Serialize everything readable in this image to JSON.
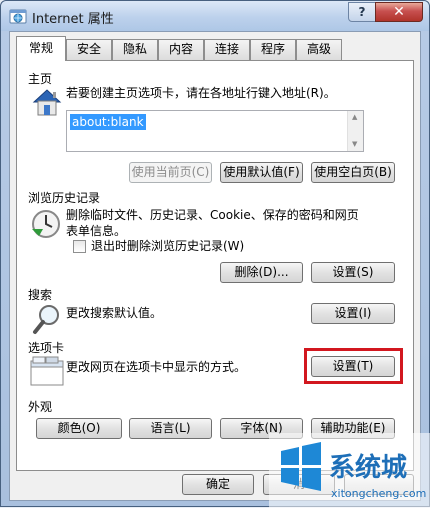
{
  "window": {
    "title": "Internet 属性",
    "help_glyph": "?",
    "close_glyph": "✕"
  },
  "tabs": [
    {
      "label": "常规"
    },
    {
      "label": "安全"
    },
    {
      "label": "隐私"
    },
    {
      "label": "内容"
    },
    {
      "label": "连接"
    },
    {
      "label": "程序"
    },
    {
      "label": "高级"
    }
  ],
  "home": {
    "title": "主页",
    "desc": "若要创建主页选项卡，请在各地址行键入地址(R)。",
    "url": "about:blank",
    "buttons": {
      "use_current": "使用当前页(C)",
      "use_default": "使用默认值(F)",
      "use_blank": "使用空白页(B)"
    }
  },
  "history": {
    "title": "浏览历史记录",
    "desc_line1": "删除临时文件、历史记录、Cookie、保存的密码和网页",
    "desc_line2": "表单信息。",
    "checkbox_label": "退出时删除浏览历史记录(W)",
    "checkbox_checked": false,
    "delete_button": "删除(D)...",
    "settings_button": "设置(S)"
  },
  "search": {
    "title": "搜索",
    "desc": "更改搜索默认值。",
    "settings_button": "设置(I)"
  },
  "tabsec": {
    "title": "选项卡",
    "desc": "更改网页在选项卡中显示的方式。",
    "settings_button": "设置(T)"
  },
  "appearance": {
    "title": "外观",
    "colors": "颜色(O)",
    "languages": "语言(L)",
    "fonts": "字体(N)",
    "accessibility": "辅助功能(E)"
  },
  "footer": {
    "ok": "确定",
    "cancel_partial": "消"
  },
  "watermark": {
    "brand": "系统城",
    "url": "xitongcheng.com"
  },
  "colors": {
    "highlight": "#d2171f",
    "selection": "#3399ff",
    "close_button": "#c75050"
  }
}
